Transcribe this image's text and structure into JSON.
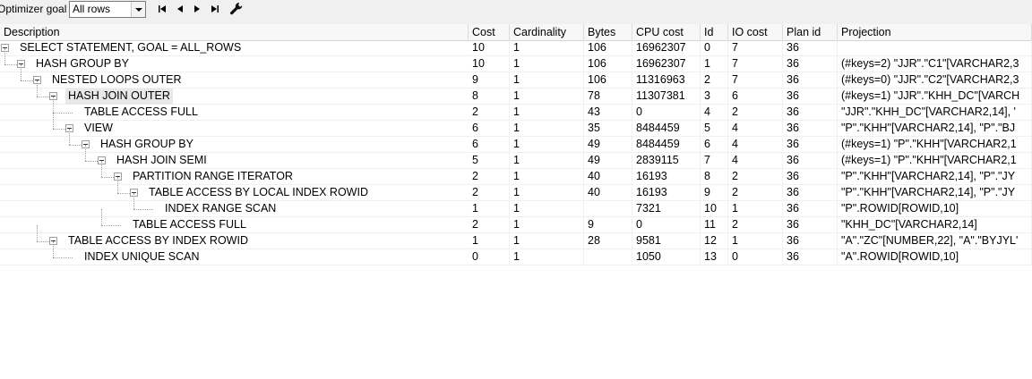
{
  "toolbar": {
    "optimizer_label": "Optimizer goal",
    "goal_value": "All rows",
    "icons": [
      "first-icon",
      "prev-icon",
      "next-icon",
      "last-icon",
      "wrench-icon"
    ]
  },
  "columns": [
    "Description",
    "Cost",
    "Cardinality",
    "Bytes",
    "CPU cost",
    "Id",
    "IO cost",
    "Plan id",
    "Projection"
  ],
  "rows": [
    {
      "depth": 0,
      "toggle": true,
      "description": "SELECT STATEMENT, GOAL = ALL_ROWS",
      "cost": "10",
      "cardinality": "1",
      "bytes": "106",
      "cpu_cost": "16962307",
      "id": "0",
      "io_cost": "7",
      "plan_id": "36",
      "projection": ""
    },
    {
      "depth": 1,
      "toggle": true,
      "description": "HASH GROUP BY",
      "cost": "10",
      "cardinality": "1",
      "bytes": "106",
      "cpu_cost": "16962307",
      "id": "1",
      "io_cost": "7",
      "plan_id": "36",
      "projection": "(#keys=2) \"JJR\".\"C1\"[VARCHAR2,3"
    },
    {
      "depth": 2,
      "toggle": true,
      "description": "NESTED LOOPS OUTER",
      "cost": "9",
      "cardinality": "1",
      "bytes": "106",
      "cpu_cost": "11316963",
      "id": "2",
      "io_cost": "7",
      "plan_id": "36",
      "projection": "(#keys=0) \"JJR\".\"C2\"[VARCHAR2,3"
    },
    {
      "depth": 3,
      "toggle": true,
      "highlight": true,
      "description": "HASH JOIN OUTER",
      "cost": "8",
      "cardinality": "1",
      "bytes": "78",
      "cpu_cost": "11307381",
      "id": "3",
      "io_cost": "6",
      "plan_id": "36",
      "projection": "(#keys=1) \"JJR\".\"KHH_DC\"[VARCH"
    },
    {
      "depth": 4,
      "toggle": false,
      "description": "TABLE ACCESS FULL",
      "cost": "2",
      "cardinality": "1",
      "bytes": "43",
      "cpu_cost": "0",
      "id": "4",
      "io_cost": "2",
      "plan_id": "36",
      "projection": "\"JJR\".\"KHH_DC\"[VARCHAR2,14], '"
    },
    {
      "depth": 4,
      "toggle": true,
      "description": "VIEW",
      "cost": "6",
      "cardinality": "1",
      "bytes": "35",
      "cpu_cost": "8484459",
      "id": "5",
      "io_cost": "4",
      "plan_id": "36",
      "projection": "\"P\".\"KHH\"[VARCHAR2,14], \"P\".\"BJ"
    },
    {
      "depth": 5,
      "toggle": true,
      "description": "HASH GROUP BY",
      "cost": "6",
      "cardinality": "1",
      "bytes": "49",
      "cpu_cost": "8484459",
      "id": "6",
      "io_cost": "4",
      "plan_id": "36",
      "projection": "(#keys=1) \"P\".\"KHH\"[VARCHAR2,1"
    },
    {
      "depth": 6,
      "toggle": true,
      "description": "HASH JOIN SEMI",
      "cost": "5",
      "cardinality": "1",
      "bytes": "49",
      "cpu_cost": "2839115",
      "id": "7",
      "io_cost": "4",
      "plan_id": "36",
      "projection": "(#keys=1) \"P\".\"KHH\"[VARCHAR2,1"
    },
    {
      "depth": 7,
      "toggle": true,
      "description": "PARTITION RANGE ITERATOR",
      "cost": "2",
      "cardinality": "1",
      "bytes": "40",
      "cpu_cost": "16193",
      "id": "8",
      "io_cost": "2",
      "plan_id": "36",
      "projection": "\"P\".\"KHH\"[VARCHAR2,14], \"P\".\"JY"
    },
    {
      "depth": 8,
      "toggle": true,
      "description": "TABLE ACCESS BY LOCAL INDEX ROWID",
      "cost": "2",
      "cardinality": "1",
      "bytes": "40",
      "cpu_cost": "16193",
      "id": "9",
      "io_cost": "2",
      "plan_id": "36",
      "projection": "\"P\".\"KHH\"[VARCHAR2,14], \"P\".\"JY"
    },
    {
      "depth": 9,
      "toggle": false,
      "description": "INDEX RANGE SCAN",
      "cost": "1",
      "cardinality": "1",
      "bytes": "",
      "cpu_cost": "7321",
      "id": "10",
      "io_cost": "1",
      "plan_id": "36",
      "projection": "\"P\".ROWID[ROWID,10]"
    },
    {
      "depth": 7,
      "toggle": false,
      "description": "TABLE ACCESS FULL",
      "cost": "2",
      "cardinality": "1",
      "bytes": "9",
      "cpu_cost": "0",
      "id": "11",
      "io_cost": "2",
      "plan_id": "36",
      "projection": "\"KHH_DC\"[VARCHAR2,14]"
    },
    {
      "depth": 3,
      "toggle": true,
      "description": "TABLE ACCESS BY INDEX ROWID",
      "cost": "1",
      "cardinality": "1",
      "bytes": "28",
      "cpu_cost": "9581",
      "id": "12",
      "io_cost": "1",
      "plan_id": "36",
      "projection": "\"A\".\"ZC\"[NUMBER,22], \"A\".\"BYJYL'"
    },
    {
      "depth": 4,
      "toggle": false,
      "description": "INDEX UNIQUE SCAN",
      "cost": "0",
      "cardinality": "1",
      "bytes": "",
      "cpu_cost": "1050",
      "id": "13",
      "io_cost": "0",
      "plan_id": "36",
      "projection": "\"A\".ROWID[ROWID,10]"
    }
  ]
}
